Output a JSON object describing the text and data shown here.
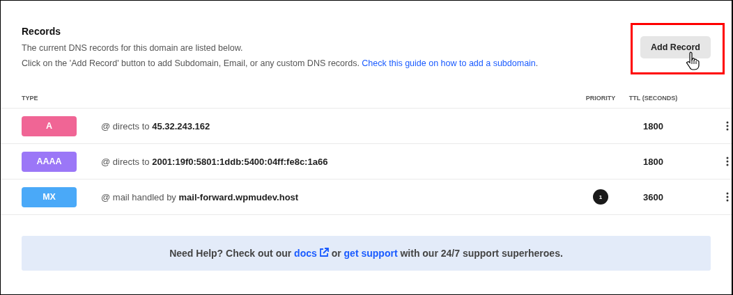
{
  "title": "Records",
  "description": [
    "The current DNS records for this domain are listed below.",
    {
      "text": "Click on the 'Add Record' button to add Subdomain, Email, or any custom DNS records. ",
      "link": "Check this guide on how to add a subdomain",
      "after": "."
    }
  ],
  "add_button": "Add Record",
  "columns": {
    "type": "TYPE",
    "priority": "PRIORITY",
    "ttl": "TTL (SECONDS)"
  },
  "records": [
    {
      "type": "A",
      "color": "#f06595",
      "value": "@ directs to **45.32.243.162**",
      "ttl": "1800"
    },
    {
      "type": "AAAA",
      "color": "#9b77f7",
      "value": "@ directs to **2001:19f0:5801:1ddb:5400:04ff:fe8c:1a66**",
      "ttl": "1800"
    },
    {
      "type": "MX",
      "color": "#4aa9f8",
      "value": "@ mail handled by **mail-forward.wpmudev.host**",
      "priority": "1",
      "ttl": "3600"
    }
  ],
  "help": {
    "before": "Need Help? Check out our ",
    "docs_link": "docs",
    "middle": " or ",
    "support_link": "get support",
    "after": " with our 24/7 support superheroes."
  }
}
